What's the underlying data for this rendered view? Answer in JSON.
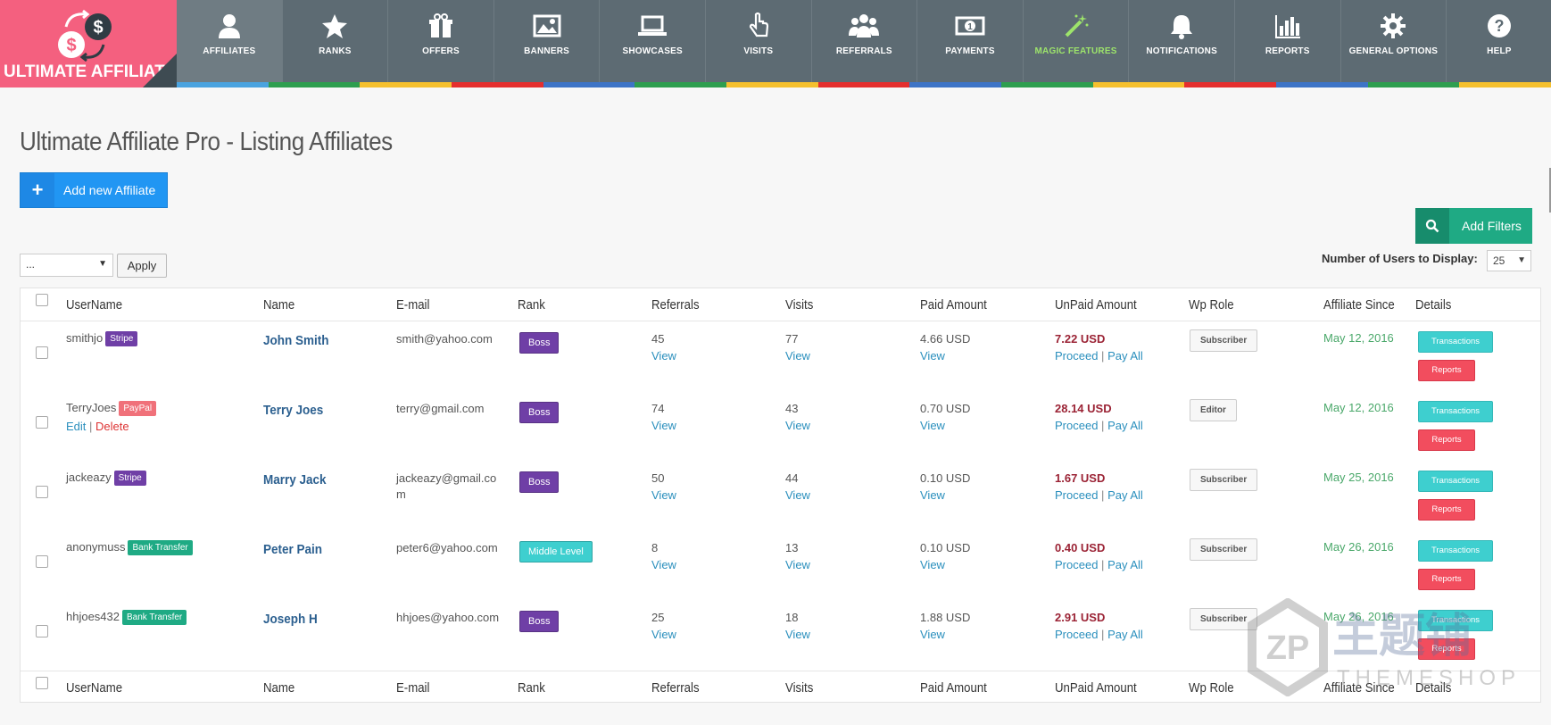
{
  "app": {
    "logo_text": "ULTIMATE AFFILIATE"
  },
  "nav": [
    {
      "label": "AFFILIATES",
      "icon": "user-icon",
      "active": true
    },
    {
      "label": "RANKS",
      "icon": "star-icon"
    },
    {
      "label": "OFFERS",
      "icon": "gift-icon"
    },
    {
      "label": "BANNERS",
      "icon": "image-icon"
    },
    {
      "label": "SHOWCASES",
      "icon": "laptop-icon"
    },
    {
      "label": "VISITS",
      "icon": "pointer-icon"
    },
    {
      "label": "REFERRALS",
      "icon": "users-icon"
    },
    {
      "label": "PAYMENTS",
      "icon": "money-icon"
    },
    {
      "label": "MAGIC FEATURES",
      "icon": "magic-wand-icon"
    },
    {
      "label": "NOTIFICATIONS",
      "icon": "bell-icon"
    },
    {
      "label": "REPORTS",
      "icon": "bar-chart-icon"
    },
    {
      "label": "GENERAL OPTIONS",
      "icon": "gear-icon"
    },
    {
      "label": "HELP",
      "icon": "question-icon"
    }
  ],
  "stripe_colors": [
    "#4aa3df",
    "#2e9e4f",
    "#f5c02e",
    "#e52e2e",
    "#3e74c6",
    "#2e9e4f",
    "#f5c02e",
    "#e52e2e",
    "#3e74c6",
    "#2e9e4f",
    "#f5c02e",
    "#e52e2e",
    "#3e74c6",
    "#2e9e4f",
    "#f5c02e"
  ],
  "page": {
    "title": "Ultimate Affiliate Pro - Listing Affiliates",
    "add_button": "Add new Affiliate",
    "add_filters": "Add Filters",
    "bulk_action_value": "...",
    "apply": "Apply",
    "users_display_label": "Number of Users to Display:",
    "users_display_value": "25"
  },
  "table": {
    "headers": {
      "username": "UserName",
      "name": "Name",
      "email": "E-mail",
      "rank": "Rank",
      "referrals": "Referrals",
      "visits": "Visits",
      "paid": "Paid Amount",
      "unpaid": "UnPaid Amount",
      "role": "Wp Role",
      "since": "Affiliate Since",
      "details": "Details"
    },
    "view_label": "View",
    "proceed_label": "Proceed",
    "pay_all_label": "Pay All",
    "separator": "|",
    "transactions_label": "Transactions",
    "reports_label": "Reports",
    "edit_label": "Edit",
    "delete_label": "Delete",
    "rows": [
      {
        "username": "smithjo",
        "method": "Stripe",
        "method_color": "#6f3fa6",
        "name": "John Smith",
        "email": "smith@yahoo.com",
        "rank": "Boss",
        "rank_color": "#6f3fa6",
        "referrals": "45",
        "visits": "77",
        "paid": "4.66 USD",
        "unpaid": "7.22 USD",
        "role": "Subscriber",
        "since": "May 12, 2016"
      },
      {
        "username": "TerryJoes",
        "method": "PayPal",
        "method_color": "#f0717a",
        "name": "Terry Joes",
        "email": "terry@gmail.com",
        "rank": "Boss",
        "rank_color": "#6f3fa6",
        "referrals": "74",
        "visits": "43",
        "paid": "0.70 USD",
        "unpaid": "28.14 USD",
        "role": "Editor",
        "since": "May 12, 2016"
      },
      {
        "username": "jackeazy",
        "method": "Stripe",
        "method_color": "#6f3fa6",
        "name": "Marry Jack",
        "email": "jackeazy@gmail.com",
        "rank": "Boss",
        "rank_color": "#6f3fa6",
        "referrals": "50",
        "visits": "44",
        "paid": "0.10 USD",
        "unpaid": "1.67 USD",
        "role": "Subscriber",
        "since": "May 25, 2016"
      },
      {
        "username": "anonymuss",
        "method": "Bank Transfer",
        "method_color": "#1faa84",
        "name": "Peter Pain",
        "email": "peter6@yahoo.com",
        "rank": "Middle Level",
        "rank_color": "#3ecfcf",
        "referrals": "8",
        "visits": "13",
        "paid": "0.10 USD",
        "unpaid": "0.40 USD",
        "role": "Subscriber",
        "since": "May 26, 2016"
      },
      {
        "username": "hhjoes432",
        "method": "Bank Transfer",
        "method_color": "#1faa84",
        "name": "Joseph H",
        "email": "hhjoes@yahoo.com",
        "rank": "Boss",
        "rank_color": "#6f3fa6",
        "referrals": "25",
        "visits": "18",
        "paid": "1.88 USD",
        "unpaid": "2.91 USD",
        "role": "Subscriber",
        "since": "May 26, 2016"
      }
    ]
  },
  "watermark": {
    "main": "主题铺",
    "sub": "THEMESHOP"
  }
}
